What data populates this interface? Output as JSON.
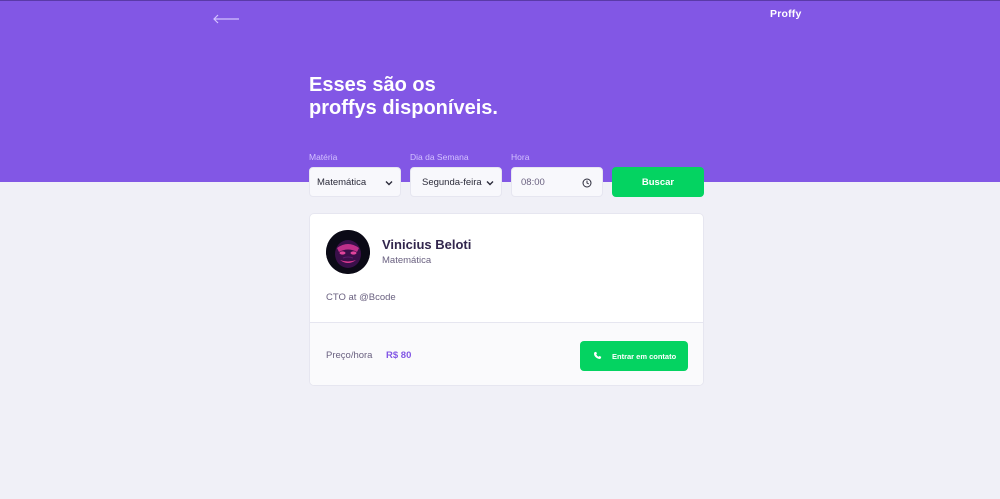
{
  "app": {
    "logo": "Proffy"
  },
  "header": {
    "title_line1": "Esses são os",
    "title_line2": "proffys disponíveis."
  },
  "filters": {
    "subject": {
      "label": "Matéria",
      "value": "Matemática"
    },
    "weekday": {
      "label": "Dia da Semana",
      "value": "Segunda-feira"
    },
    "time": {
      "label": "Hora",
      "value": "08:00"
    },
    "search_label": "Buscar"
  },
  "teacher": {
    "name": "Vinicius Beloti",
    "subject": "Matemática",
    "bio": "CTO at @Bcode",
    "price_label": "Preço/hora",
    "price_value": "R$ 80",
    "contact_label": "Entrar em contato"
  },
  "colors": {
    "primary": "#8257e5",
    "secondary": "#04d361",
    "background": "#f0f0f7"
  },
  "icons": [
    "back-arrow-icon",
    "chevron-down-icon",
    "clock-icon",
    "whatsapp-icon"
  ]
}
